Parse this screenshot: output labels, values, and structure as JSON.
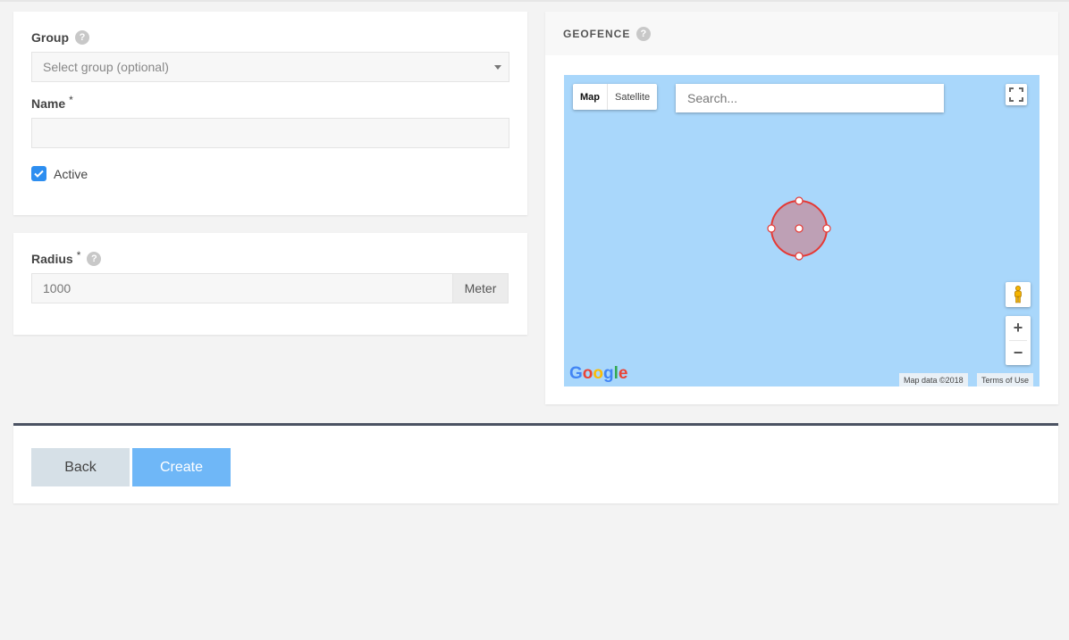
{
  "form": {
    "group_label": "Group",
    "group_placeholder": "Select group (optional)",
    "name_label": "Name",
    "name_required": "*",
    "name_value": "",
    "active_label": "Active",
    "active_checked": true
  },
  "radius": {
    "label": "Radius",
    "required": "*",
    "value": "1000",
    "unit": "Meter"
  },
  "geofence": {
    "title": "GEOFENCE",
    "map_type_map": "Map",
    "map_type_satellite": "Satellite",
    "search_placeholder": "Search...",
    "zoom_in": "+",
    "zoom_out": "−",
    "logo": "Google",
    "map_data": "Map data ©2018",
    "terms": "Terms of Use",
    "circle_color": "#e53935",
    "water_color": "#a9d7fb"
  },
  "actions": {
    "back_label": "Back",
    "create_label": "Create"
  },
  "help_glyph": "?",
  "icons": [
    "help-icon",
    "caret-down-icon",
    "check-icon",
    "fullscreen-icon",
    "pegman-icon"
  ]
}
